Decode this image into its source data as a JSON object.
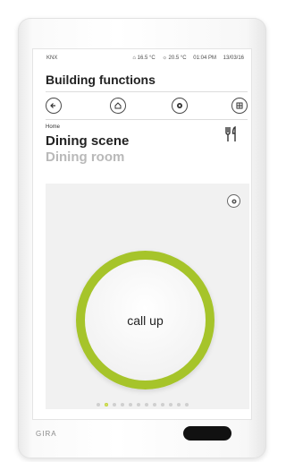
{
  "statusbar": {
    "system": "KNX",
    "temp_inside": "16.5 °C",
    "temp_outside": "20.5 °C",
    "time": "01:04 PM",
    "date": "13/03/16"
  },
  "header": {
    "title": "Building functions"
  },
  "nav": {
    "back": "back-icon",
    "home": "home-icon",
    "settings": "settings-icon",
    "grid": "grid-icon"
  },
  "content": {
    "breadcrumb": "Home",
    "scene_name": "Dining scene",
    "room_name": "Dining room",
    "icon": "cutlery-icon",
    "button_label": "call up"
  },
  "pager": {
    "count": 12,
    "active_index": 1
  },
  "device": {
    "brand": "GIRA"
  },
  "colors": {
    "ring": "#a6c42a",
    "active_dot": "#d6e26a"
  }
}
